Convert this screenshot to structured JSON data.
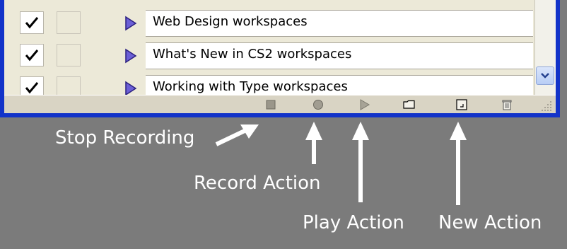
{
  "actions_panel": {
    "items": [
      {
        "label": "Web Design workspaces",
        "checked": true
      },
      {
        "label": "What's New in CS2 workspaces",
        "checked": true
      },
      {
        "label": "Working with Type workspaces",
        "checked": true
      }
    ],
    "toolbar": {
      "buttons": [
        {
          "name": "stop-recording",
          "icon": "stop-square-icon"
        },
        {
          "name": "record-action",
          "icon": "record-circle-icon"
        },
        {
          "name": "play-action",
          "icon": "play-triangle-icon"
        },
        {
          "name": "new-set",
          "icon": "folder-icon"
        },
        {
          "name": "new-action",
          "icon": "new-page-icon"
        },
        {
          "name": "delete",
          "icon": "trash-icon"
        }
      ]
    }
  },
  "annotations": {
    "stop_recording": "Stop Recording",
    "record_action": "Record Action",
    "play_action": "Play Action",
    "new_action": "New Action"
  },
  "colors": {
    "frame": "#1233c9",
    "background": "#7b7b7b",
    "panel": "#d4d0c8",
    "triangle": "#6b5fd6"
  }
}
